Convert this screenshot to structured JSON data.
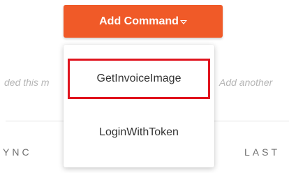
{
  "background": {
    "hint_left": "ded this m",
    "hint_right": "Add another",
    "table_header_left": "YNC",
    "table_header_right": "LAST"
  },
  "add_command": {
    "label": "Add Command",
    "icon": "chevron-down-icon",
    "color": "#f05a28"
  },
  "menu": {
    "items": [
      {
        "label": "GetInvoiceImage",
        "highlighted": true
      },
      {
        "label": "LoginWithToken",
        "highlighted": false
      }
    ],
    "highlight_color": "#e0141e"
  }
}
